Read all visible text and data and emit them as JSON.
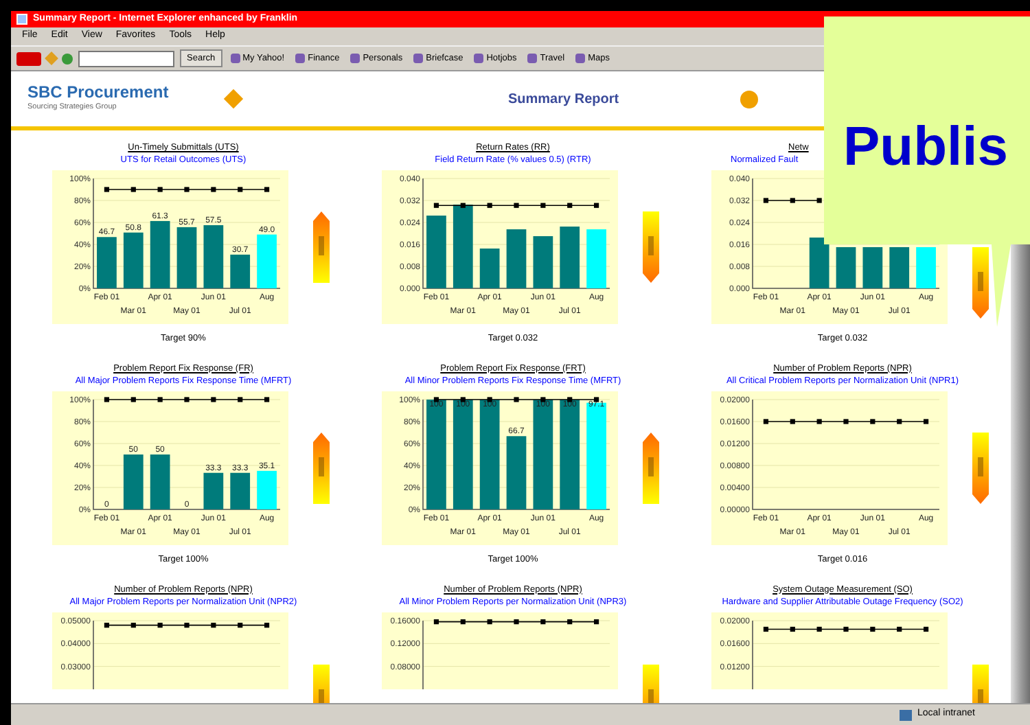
{
  "window": {
    "title": "Summary Report - Internet Explorer enhanced by Franklin"
  },
  "menu": [
    "File",
    "Edit",
    "View",
    "Favorites",
    "Tools",
    "Help"
  ],
  "toolbar": {
    "search_button": "Search",
    "links": [
      "My Yahoo!",
      "Finance",
      "Personals",
      "Briefcase",
      "Hotjobs",
      "Travel",
      "Maps"
    ]
  },
  "header": {
    "brand": "SBC Procurement",
    "tagline": "Sourcing Strategies Group",
    "title": "Summary Report"
  },
  "charts": [
    {
      "title": "Un-Timely Submittals (UTS)",
      "subtitle": "UTS for Retail Outcomes (UTS)",
      "target": "Target 90%",
      "rising": true,
      "chart_data": {
        "type": "bar",
        "grid": true,
        "categories": [
          "Feb 01",
          "Mar 01",
          "Apr 01",
          "May 01",
          "Jun 01",
          "Jul 01",
          "Aug"
        ],
        "ylim": [
          0,
          100
        ],
        "yticks": [
          {
            "value": 0,
            "label": "0%"
          },
          {
            "value": 20,
            "label": "20%"
          },
          {
            "value": 40,
            "label": "40%"
          },
          {
            "value": 60,
            "label": "60%"
          },
          {
            "value": 80,
            "label": "80%"
          },
          {
            "value": 100,
            "label": "100%"
          }
        ],
        "value_labels": [
          "46.7",
          "50.8",
          "61.3",
          "55.7",
          "57.5",
          "30.7",
          "49.0"
        ],
        "series": [
          {
            "color": "#007b7b",
            "values": [
              46.7,
              50.8,
              61.3,
              55.7,
              57.5,
              30.7,
              null
            ]
          },
          {
            "color": "#00ffff",
            "values": [
              null,
              null,
              null,
              null,
              null,
              null,
              49.0
            ]
          },
          {
            "type": "line",
            "marker": "square",
            "color": "#000000",
            "values": [
              90,
              90,
              90,
              90,
              90,
              90,
              90
            ]
          }
        ]
      }
    },
    {
      "title": "Return Rates (RR)",
      "subtitle": "Field Return Rate (% values 0.5) (RTR)",
      "target": "Target 0.032",
      "rising": false,
      "chart_data": {
        "type": "bar",
        "grid": true,
        "categories": [
          "Feb 01",
          "Mar 01",
          "Apr 01",
          "May 01",
          "Jun 01",
          "Jul 01",
          "Aug"
        ],
        "ylim": [
          0,
          0.04
        ],
        "yticks": [
          {
            "value": 0,
            "label": "0.000"
          },
          {
            "value": 0.008,
            "label": "0.008"
          },
          {
            "value": 0.016,
            "label": "0.016"
          },
          {
            "value": 0.024,
            "label": "0.024"
          },
          {
            "value": 0.032,
            "label": "0.032"
          },
          {
            "value": 0.04,
            "label": "0.040"
          }
        ],
        "series": [
          {
            "color": "#007b7b",
            "values": [
              0.0265,
              0.0305,
              0.0145,
              0.0215,
              0.019,
              0.0225,
              null
            ]
          },
          {
            "color": "#00ffff",
            "values": [
              null,
              null,
              null,
              null,
              null,
              null,
              0.0215
            ]
          },
          {
            "type": "line",
            "marker": "square",
            "color": "#000000",
            "values": [
              0.0302,
              0.0302,
              0.0302,
              0.0302,
              0.0302,
              0.0302,
              0.0302
            ]
          }
        ]
      }
    },
    {
      "title": "Netw",
      "subtitle": "Normalized Fault",
      "target": "Target 0.032",
      "rising": false,
      "chart_data": {
        "type": "bar",
        "grid": true,
        "categories": [
          "Feb 01",
          "Mar 01",
          "Apr 01",
          "May 01",
          "Jun 01",
          "Jul 01",
          "Aug"
        ],
        "ylim": [
          0,
          0.04
        ],
        "yticks": [
          {
            "value": 0,
            "label": "0.000"
          },
          {
            "value": 0.008,
            "label": "0.008"
          },
          {
            "value": 0.016,
            "label": "0.016"
          },
          {
            "value": 0.024,
            "label": "0.024"
          },
          {
            "value": 0.032,
            "label": "0.032"
          },
          {
            "value": 0.04,
            "label": "0.040"
          }
        ],
        "series": [
          {
            "color": "#007b7b",
            "values": [
              null,
              null,
              0.0185,
              0.015,
              0.015,
              0.015,
              null
            ]
          },
          {
            "color": "#00ffff",
            "values": [
              null,
              null,
              null,
              null,
              null,
              null,
              0.015
            ]
          },
          {
            "type": "line",
            "marker": "square",
            "color": "#000000",
            "values": [
              0.032,
              0.032,
              0.032,
              null,
              null,
              null,
              null
            ]
          }
        ]
      }
    },
    {
      "title": "Problem Report Fix Response (FR)",
      "subtitle": "All Major Problem Reports Fix Response Time (MFRT)",
      "target": "Target 100%",
      "rising": true,
      "chart_data": {
        "type": "bar",
        "grid": true,
        "categories": [
          "Feb 01",
          "Mar 01",
          "Apr 01",
          "May 01",
          "Jun 01",
          "Jul 01",
          "Aug"
        ],
        "ylim": [
          0,
          100
        ],
        "yticks": [
          {
            "value": 0,
            "label": "0%"
          },
          {
            "value": 20,
            "label": "20%"
          },
          {
            "value": 40,
            "label": "40%"
          },
          {
            "value": 60,
            "label": "60%"
          },
          {
            "value": 80,
            "label": "80%"
          },
          {
            "value": 100,
            "label": "100%"
          }
        ],
        "value_labels": [
          "0",
          "50",
          "50",
          "0",
          "33.3",
          "33.3",
          "35.1"
        ],
        "series": [
          {
            "color": "#007b7b",
            "values": [
              0,
              50,
              50,
              0,
              33.3,
              33.3,
              null
            ]
          },
          {
            "color": "#00ffff",
            "values": [
              null,
              null,
              null,
              null,
              null,
              null,
              35.1
            ]
          },
          {
            "type": "line",
            "marker": "square",
            "color": "#000000",
            "values": [
              100,
              100,
              100,
              100,
              100,
              100,
              100
            ]
          }
        ]
      }
    },
    {
      "title": "Problem Report Fix Response (FRT)",
      "subtitle": "All Minor Problem Reports Fix Response Time (MFRT)",
      "target": "Target 100%",
      "rising": true,
      "chart_data": {
        "type": "bar",
        "grid": true,
        "categories": [
          "Feb 01",
          "Mar 01",
          "Apr 01",
          "May 01",
          "Jun 01",
          "Jul 01",
          "Aug"
        ],
        "ylim": [
          0,
          100
        ],
        "yticks": [
          {
            "value": 0,
            "label": "0%"
          },
          {
            "value": 20,
            "label": "20%"
          },
          {
            "value": 40,
            "label": "40%"
          },
          {
            "value": 60,
            "label": "60%"
          },
          {
            "value": 80,
            "label": "80%"
          },
          {
            "value": 100,
            "label": "100%"
          }
        ],
        "value_labels": [
          "100",
          "100",
          "100",
          "66.7",
          "100",
          "100",
          "97.1"
        ],
        "series": [
          {
            "color": "#007b7b",
            "values": [
              100,
              100,
              100,
              66.7,
              100,
              100,
              null
            ]
          },
          {
            "color": "#00ffff",
            "values": [
              null,
              null,
              null,
              null,
              null,
              null,
              97.1
            ]
          },
          {
            "type": "line",
            "marker": "square",
            "color": "#000000",
            "values": [
              100,
              100,
              100,
              100,
              100,
              100,
              100
            ]
          }
        ]
      }
    },
    {
      "title": "Number of Problem Reports (NPR)",
      "subtitle": "All Critical Problem Reports per Normalization Unit (NPR1)",
      "target": "Target 0.016",
      "rising": false,
      "chart_data": {
        "type": "line",
        "grid": true,
        "categories": [
          "Feb 01",
          "Mar 01",
          "Apr 01",
          "May 01",
          "Jun 01",
          "Jul 01",
          "Aug"
        ],
        "ylim": [
          0,
          0.02
        ],
        "yticks": [
          {
            "value": 0,
            "label": "0.00000"
          },
          {
            "value": 0.004,
            "label": "0.00400"
          },
          {
            "value": 0.008,
            "label": "0.00800"
          },
          {
            "value": 0.012,
            "label": "0.01200"
          },
          {
            "value": 0.016,
            "label": "0.01600"
          },
          {
            "value": 0.02,
            "label": "0.02000"
          }
        ],
        "series": [
          {
            "marker": "square",
            "color": "#000000",
            "values": [
              0.016,
              0.016,
              0.016,
              0.016,
              0.016,
              0.016,
              0.016
            ]
          }
        ]
      }
    },
    {
      "title": "Number of Problem Reports (NPR)",
      "subtitle": "All Major Problem Reports per Normalization Unit (NPR2)",
      "rising": false,
      "chart_data": {
        "type": "line",
        "grid": true,
        "ylim": [
          0.02,
          0.05
        ],
        "yticks": [
          {
            "value": 0.03,
            "label": "0.03000"
          },
          {
            "value": 0.04,
            "label": "0.04000"
          },
          {
            "value": 0.05,
            "label": "0.05000"
          }
        ],
        "series": [
          {
            "marker": "square",
            "color": "#000000",
            "values": [
              0.048,
              0.048,
              0.048,
              0.048,
              0.048,
              0.048,
              0.048
            ]
          }
        ]
      }
    },
    {
      "title": "Number of Problem Reports (NPR)",
      "subtitle": "All Minor Problem Reports per Normalization Unit (NPR3)",
      "rising": false,
      "chart_data": {
        "type": "line",
        "grid": true,
        "ylim": [
          0.04,
          0.16
        ],
        "yticks": [
          {
            "value": 0.08,
            "label": "0.08000"
          },
          {
            "value": 0.12,
            "label": "0.12000"
          },
          {
            "value": 0.16,
            "label": "0.16000"
          }
        ],
        "series": [
          {
            "marker": "square",
            "color": "#000000",
            "values": [
              0.158,
              0.158,
              0.158,
              0.158,
              0.158,
              0.158,
              0.158
            ]
          }
        ]
      }
    },
    {
      "title": "System Outage Measurement (SO)",
      "subtitle": "Hardware and Supplier Attributable Outage Frequency (SO2)",
      "rising": false,
      "chart_data": {
        "type": "line",
        "grid": true,
        "ylim": [
          0.008,
          0.02
        ],
        "yticks": [
          {
            "value": 0.012,
            "label": "0.01200"
          },
          {
            "value": 0.016,
            "label": "0.01600"
          },
          {
            "value": 0.02,
            "label": "0.02000"
          }
        ],
        "series": [
          {
            "marker": "square",
            "color": "#000000",
            "values": [
              0.0185,
              0.0185,
              0.0185,
              0.0185,
              0.0185,
              0.0185,
              0.0185
            ]
          }
        ]
      }
    }
  ],
  "status_bar": {
    "zone": "Local intranet"
  },
  "callout": {
    "text": "Publis"
  }
}
